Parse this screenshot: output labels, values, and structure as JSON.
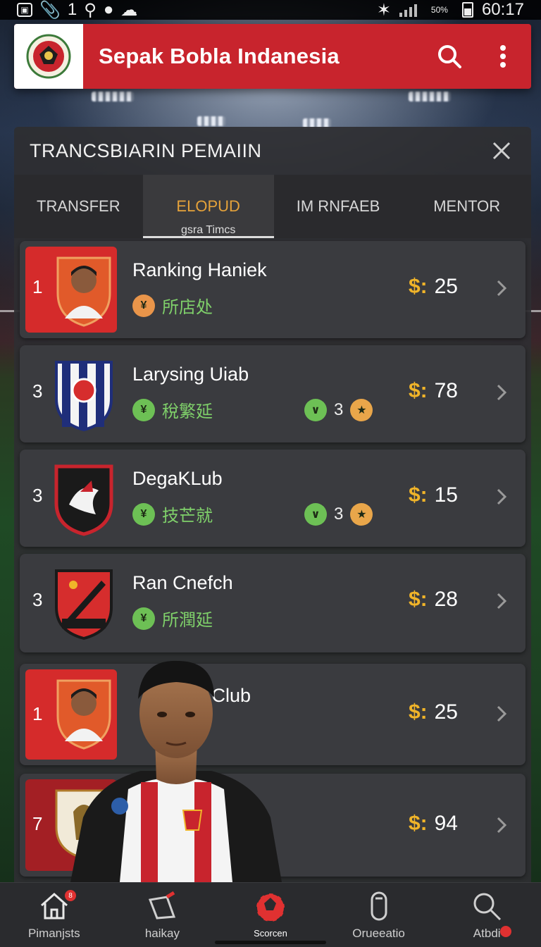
{
  "status_bar": {
    "time": "60:17",
    "battery_text": "50%"
  },
  "header": {
    "title": "Sepak Bobla Indanesia",
    "search_icon": "search-icon",
    "menu_icon": "more-vert-icon"
  },
  "panel": {
    "title": "TRANCSBIARIN PEMAIIN",
    "tabs": [
      {
        "label": "TRANSFER"
      },
      {
        "label": "ELOPUD",
        "sub": "gsra Timcs",
        "active": true
      },
      {
        "label": "IM RNFAEB"
      },
      {
        "label": "MENTOR"
      }
    ]
  },
  "list": [
    {
      "rank": "1",
      "name": "Ranking Haniek",
      "tag": "所店处",
      "price_symbol": "$:",
      "price": "25",
      "highlight": true
    },
    {
      "rank": "3",
      "name": "Larysing Uiab",
      "tag": "稅繁延",
      "extra_count": "3",
      "price_symbol": "$:",
      "price": "78"
    },
    {
      "rank": "3",
      "name": "DegaKLub",
      "tag": "技芒就",
      "extra_count": "3",
      "price_symbol": "$:",
      "price": "15"
    },
    {
      "rank": "3",
      "name": "Ran Cnefch",
      "tag": "所潤延",
      "price_symbol": "$:",
      "price": "28"
    },
    {
      "rank": "1",
      "name": "g Club",
      "price_symbol": "$:",
      "price": "25",
      "highlight": true
    },
    {
      "rank": "7",
      "name": "",
      "price_symbol": "$:",
      "price": "94",
      "highlight": true
    }
  ],
  "bottom_nav": [
    {
      "label": "Pimanjsts",
      "icon": "home-icon",
      "badge": "8"
    },
    {
      "label": "haikay",
      "icon": "flag-icon"
    },
    {
      "label": "Scorcen",
      "icon": "ball-icon",
      "active": true
    },
    {
      "label": "Orueeatio",
      "icon": "device-icon"
    },
    {
      "label": "Atbdi",
      "icon": "search-icon"
    }
  ],
  "colors": {
    "brand_red": "#c8242d",
    "accent_gold": "#f0b429",
    "tag_green": "#7fd06a",
    "active_tab": "#e5a23a"
  }
}
